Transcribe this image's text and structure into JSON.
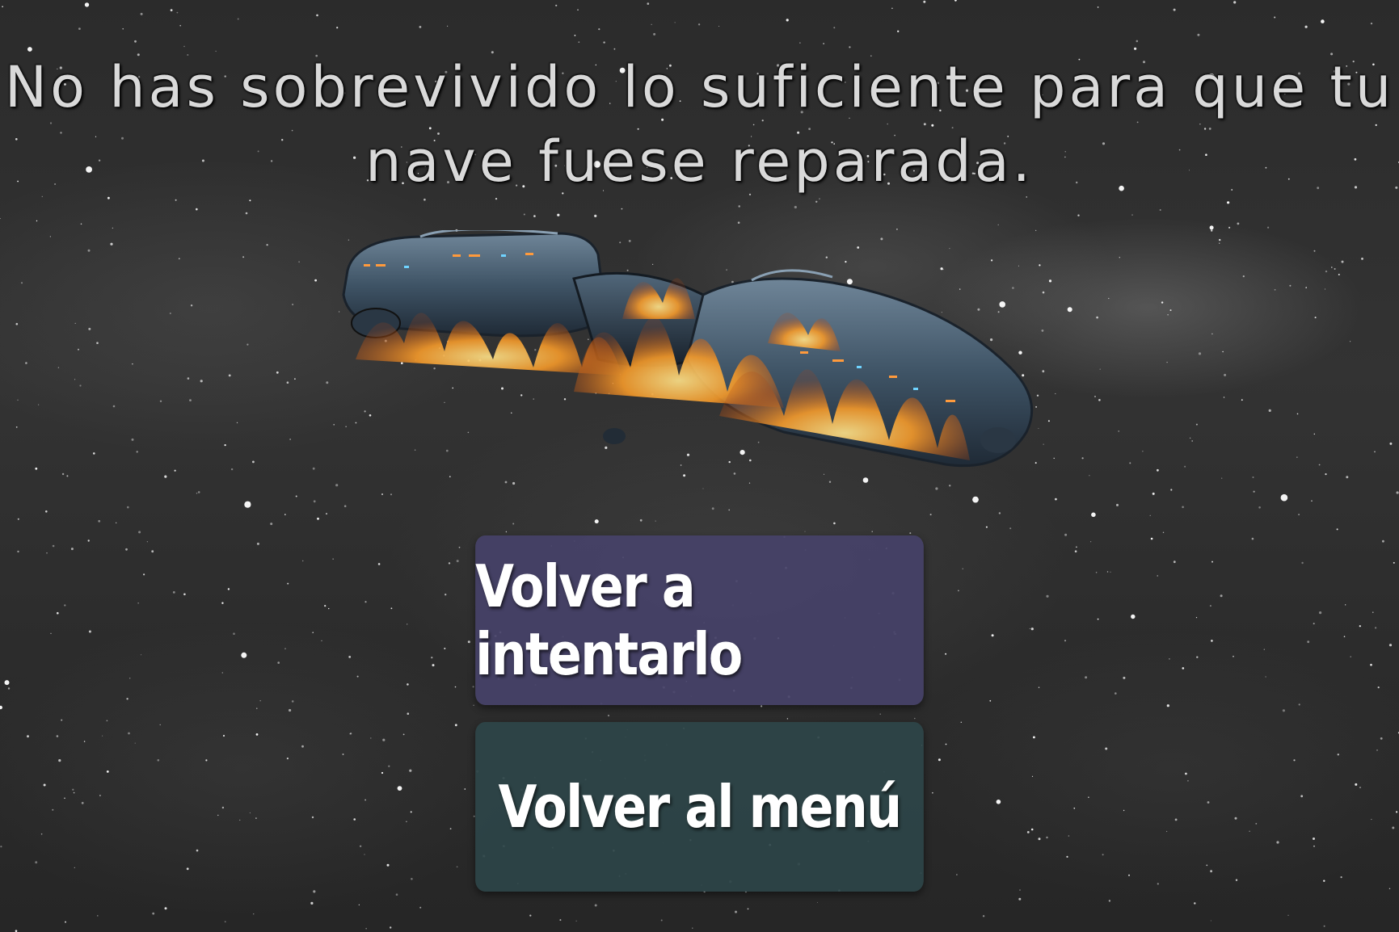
{
  "game_over": {
    "message": "No has sobrevivido lo suficiente para que tu nave fuese reparada.",
    "illustration": "burning-spaceship"
  },
  "buttons": {
    "retry_label": "Volver a intentarlo",
    "menu_label": "Volver al menú"
  },
  "colors": {
    "retry_button": "#464268",
    "menu_button": "#2d4548",
    "text": "#ffffff",
    "title_text": "#d9d9d9"
  }
}
